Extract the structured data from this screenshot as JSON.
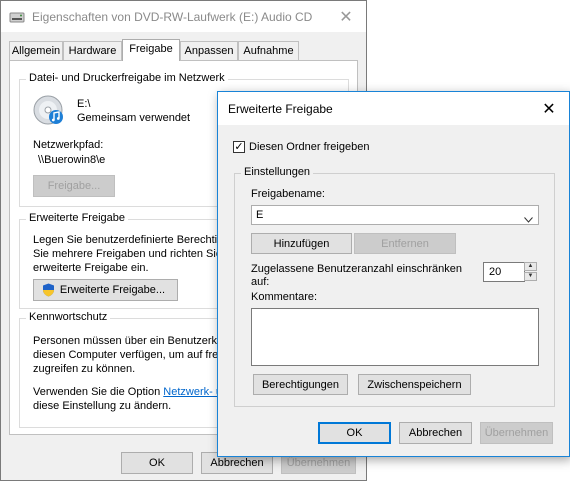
{
  "main_window": {
    "title": "Eigenschaften von DVD-RW-Laufwerk (E:) Audio CD",
    "close_glyph": "✕",
    "tabs": [
      "Allgemein",
      "Hardware",
      "Freigabe",
      "Anpassen",
      "Aufnahme"
    ],
    "active_tab": "Freigabe",
    "network_share": {
      "group_title": "Datei- und Druckerfreigabe im Netzwerk",
      "drive_label": "E:\\",
      "drive_status": "Gemeinsam verwendet",
      "network_path_label": "Netzwerkpfad:",
      "network_path": "\\\\Buerowin8\\e",
      "share_button": "Freigabe..."
    },
    "advanced_share": {
      "group_title": "Erweiterte Freigabe",
      "desc_line1": "Legen Sie benutzerdefinierte Berechtig",
      "desc_line2": "Sie mehrere Freigaben und richten Sie (",
      "desc_line3": "erweiterte Freigabe ein.",
      "button": "Erweiterte Freigabe..."
    },
    "password": {
      "group_title": "Kennwortschutz",
      "desc_line1": "Personen müssen über ein Benutzerkon",
      "desc_line2": "diesen Computer verfügen, um auf frei",
      "desc_line3": "zugreifen zu können.",
      "link_prefix": "Verwenden Sie die Option ",
      "link_text": "Netzwerk- u",
      "desc_line5": "diese Einstellung zu ändern."
    },
    "buttons": {
      "ok": "OK",
      "cancel": "Abbrechen",
      "apply": "Übernehmen"
    }
  },
  "adv_dialog": {
    "title": "Erweiterte Freigabe",
    "close_glyph": "✕",
    "share_checkbox_label": "Diesen Ordner freigeben",
    "share_checked": true,
    "check_glyph": "✓",
    "settings_group_title": "Einstellungen",
    "share_name_label": "Freigabename:",
    "share_name_value": "E",
    "add_button": "Hinzufügen",
    "remove_button": "Entfernen",
    "limit_label_line1": "Zugelassene Benutzeranzahl einschränken",
    "limit_label_line2": "auf:",
    "limit_value": "20",
    "comments_label": "Kommentare:",
    "comments_value": "",
    "permissions_button": "Berechtigungen",
    "caching_button": "Zwischenspeichern",
    "buttons": {
      "ok": "OK",
      "cancel": "Abbrechen",
      "apply": "Übernehmen"
    }
  },
  "colors": {
    "accent": "#0078d7",
    "link": "#0066cc"
  }
}
